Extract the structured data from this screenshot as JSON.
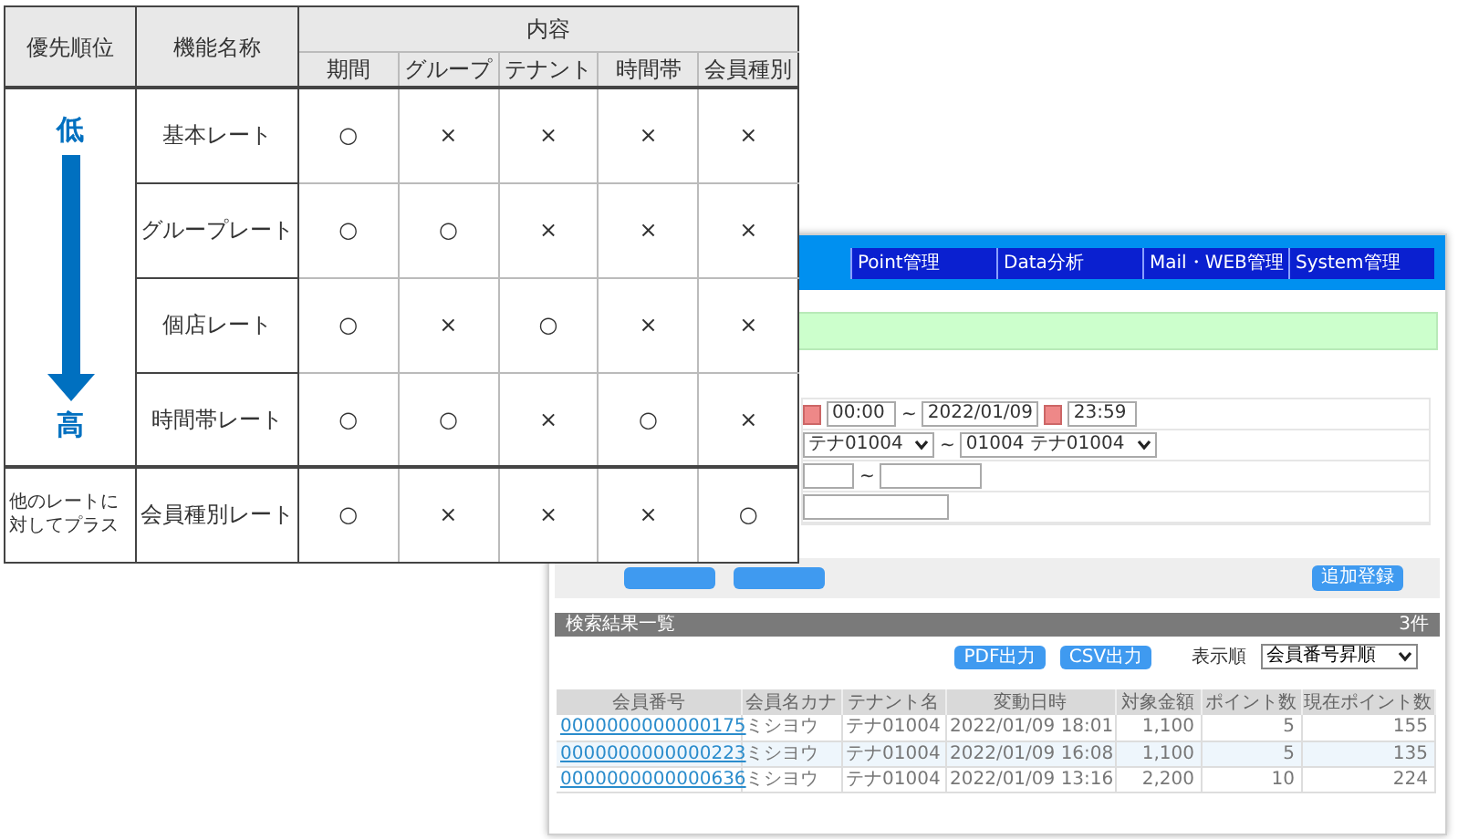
{
  "priority_table": {
    "headers": {
      "priority": "優先順位",
      "name": "機能名称",
      "content": "内容",
      "columns": [
        "期間",
        "グループ",
        "テナント",
        "時間帯",
        "会員種別"
      ]
    },
    "priority_low": "低",
    "priority_high": "高",
    "rows": [
      {
        "kind": "ranked",
        "name": "基本レート",
        "marks": [
          "○",
          "×",
          "×",
          "×",
          "×"
        ]
      },
      {
        "kind": "ranked",
        "name": "グループレート",
        "marks": [
          "○",
          "○",
          "×",
          "×",
          "×"
        ]
      },
      {
        "kind": "ranked",
        "name": "個店レート",
        "marks": [
          "○",
          "×",
          "○",
          "×",
          "×"
        ]
      },
      {
        "kind": "ranked",
        "name": "時間帯レート",
        "marks": [
          "○",
          "○",
          "×",
          "○",
          "×"
        ]
      },
      {
        "kind": "additive",
        "note": "他のレートに対してプラス",
        "name": "会員種別レート",
        "marks": [
          "○",
          "×",
          "×",
          "×",
          "○"
        ]
      }
    ]
  },
  "screenshot": {
    "nav": [
      "Point管理",
      "Data分析",
      "Mail・WEB管理",
      "System管理"
    ],
    "form": {
      "time_from": "00:00",
      "tilde": "~",
      "date_to": "2022/01/09",
      "time_to": "23:59",
      "tenant_from": "テナ01004",
      "tenant_to": "01004 テナ01004"
    },
    "add_button": "追加登録",
    "results": {
      "title": "検索結果一覧",
      "count": "3件",
      "export_buttons": [
        "PDF出力",
        "CSV出力"
      ],
      "sort_label": "表示順",
      "sort_value": "会員番号昇順",
      "columns": [
        "会員番号",
        "会員名カナ",
        "テナント名",
        "変動日時",
        "対象金額",
        "ポイント数",
        "現在ポイント数"
      ],
      "rows": [
        [
          "0000000000000175",
          "ミシヨウ",
          "テナ01004",
          "2022/01/09 18:01",
          "1,100",
          "5",
          "155"
        ],
        [
          "0000000000000223",
          "ミシヨウ",
          "テナ01004",
          "2022/01/09 16:08",
          "1,100",
          "5",
          "135"
        ],
        [
          "0000000000000636",
          "ミシヨウ",
          "テナ01004",
          "2022/01/09 13:16",
          "2,200",
          "10",
          "224"
        ]
      ]
    }
  }
}
